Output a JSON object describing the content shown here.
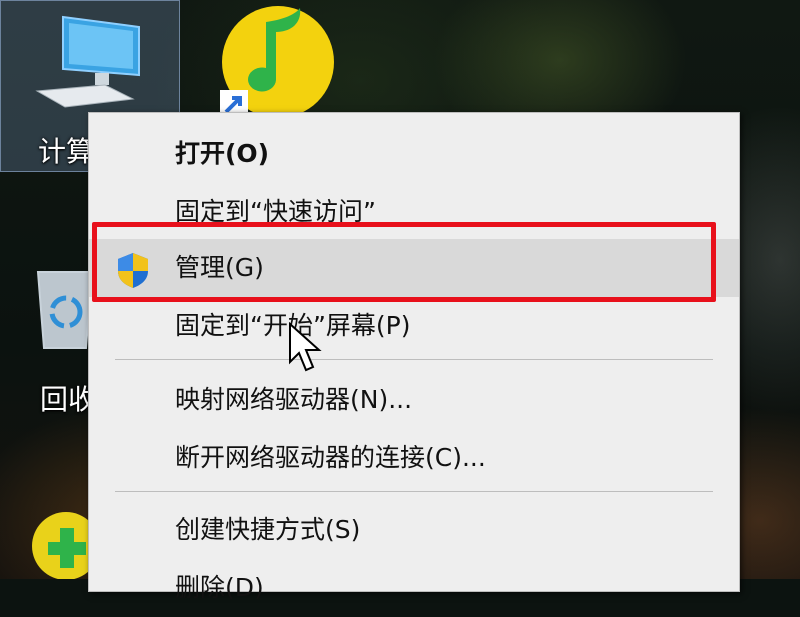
{
  "desktop": {
    "icons": [
      {
        "label": "计算",
        "name": "computer"
      },
      {
        "label": "",
        "name": "music"
      },
      {
        "label": "回收",
        "name": "recycle-bin"
      }
    ]
  },
  "context_menu": {
    "items": [
      {
        "label": "打开(O)",
        "bold": true
      },
      {
        "label": "固定到“快速访问”"
      },
      {
        "label": "管理(G)",
        "icon": "shield-icon",
        "highlighted": true
      },
      {
        "label": "固定到“开始”屏幕(P)"
      },
      {
        "label": "映射网络驱动器(N)..."
      },
      {
        "label": "断开网络驱动器的连接(C)..."
      },
      {
        "label": "创建快捷方式(S)"
      },
      {
        "label": "删除(D)"
      }
    ]
  },
  "colors": {
    "highlight_border": "#e8101b",
    "menu_background": "#eeeeee",
    "menu_hover": "#d9d9d9"
  }
}
